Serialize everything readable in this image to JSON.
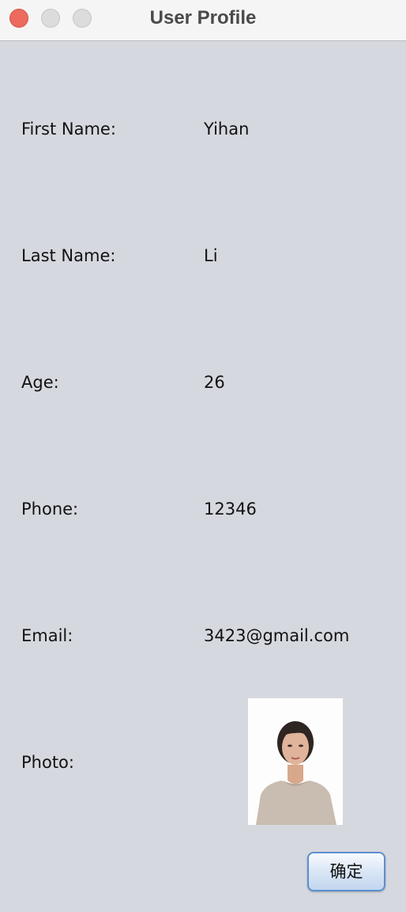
{
  "window": {
    "title": "User Profile"
  },
  "profile": {
    "first_name_label": "First Name:",
    "first_name": "Yihan",
    "last_name_label": "Last Name:",
    "last_name": "Li",
    "age_label": "Age:",
    "age": "26",
    "phone_label": "Phone:",
    "phone": "12346",
    "email_label": "Email:",
    "email": "3423@gmail.com",
    "photo_label": "Photo:"
  },
  "actions": {
    "ok_label": "确定"
  },
  "colors": {
    "window_bg": "#d6d8df",
    "titlebar_bg": "#f5f5f5",
    "close_button": "#ec6a5e",
    "button_border": "#5b8fd0"
  }
}
